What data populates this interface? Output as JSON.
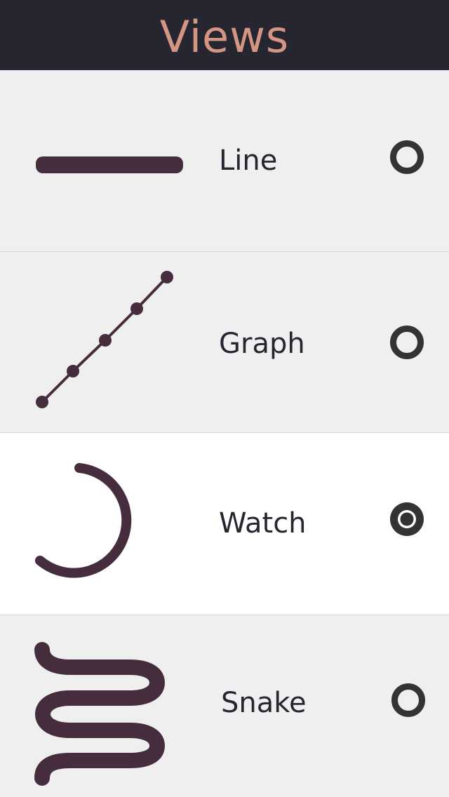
{
  "header": {
    "title": "Views"
  },
  "colors": {
    "header_bg": "#262631",
    "title": "#d49582",
    "icon": "#452d3d",
    "radio": "#333333"
  },
  "views": [
    {
      "label": "Line",
      "icon": "line-icon",
      "selected": false
    },
    {
      "label": "Graph",
      "icon": "graph-icon",
      "selected": false
    },
    {
      "label": "Watch",
      "icon": "watch-arc-icon",
      "selected": true
    },
    {
      "label": "Snake",
      "icon": "snake-icon",
      "selected": false
    }
  ]
}
